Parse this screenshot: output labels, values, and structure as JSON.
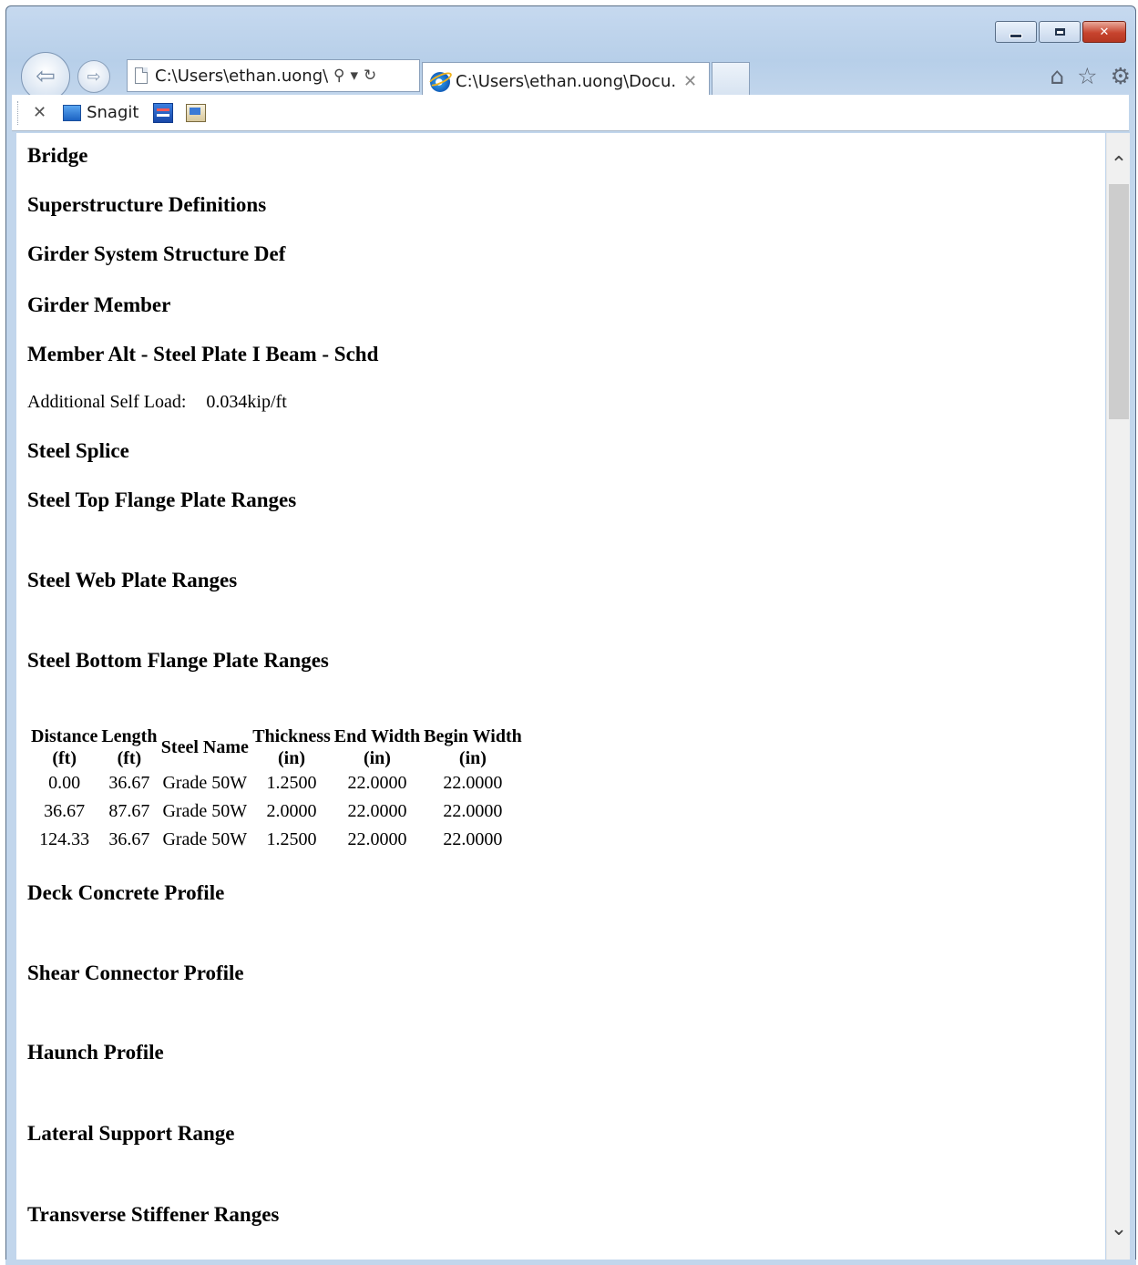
{
  "browser": {
    "address": "C:\\Users\\ethan.uong\\I",
    "tab_title": "C:\\Users\\ethan.uong\\Docu...",
    "commandbar": {
      "snagit_label": "Snagit"
    }
  },
  "page": {
    "sections": {
      "bridge": "Bridge",
      "superstructure": "Superstructure Definitions",
      "girder_system": "Girder System Structure Def",
      "girder_member": "Girder Member",
      "member_alt": "Member Alt - Steel Plate I Beam - Schd",
      "steel_splice": "Steel Splice",
      "top_flange": "Steel Top Flange Plate Ranges",
      "web_plate": "Steel Web Plate Ranges",
      "bottom_flange": "Steel Bottom Flange Plate Ranges",
      "deck_concrete": "Deck Concrete Profile",
      "shear_connector": "Shear Connector Profile",
      "haunch": "Haunch Profile",
      "lateral_support": "Lateral Support Range",
      "transverse_stiffener": "Transverse Stiffener Ranges"
    },
    "self_load": {
      "label": "Additional Self Load:",
      "value": "0.034kip/ft"
    },
    "bottom_flange_table": {
      "headers": [
        [
          "Distance",
          "(ft)"
        ],
        [
          "Length",
          "(ft)"
        ],
        [
          "Steel Name",
          ""
        ],
        [
          "Thickness",
          "(in)"
        ],
        [
          "End Width",
          "(in)"
        ],
        [
          "Begin Width",
          "(in)"
        ]
      ],
      "rows": [
        [
          "0.00",
          "36.67",
          "Grade 50W",
          "1.2500",
          "22.0000",
          "22.0000"
        ],
        [
          "36.67",
          "87.67",
          "Grade 50W",
          "2.0000",
          "22.0000",
          "22.0000"
        ],
        [
          "124.33",
          "36.67",
          "Grade 50W",
          "1.2500",
          "22.0000",
          "22.0000"
        ]
      ]
    }
  },
  "icons": {
    "back": "back-arrow-icon",
    "forward": "forward-arrow-icon",
    "search": "search-icon",
    "refresh": "refresh-icon",
    "home": "home-icon",
    "favorites": "star-icon",
    "tools": "gear-icon"
  }
}
